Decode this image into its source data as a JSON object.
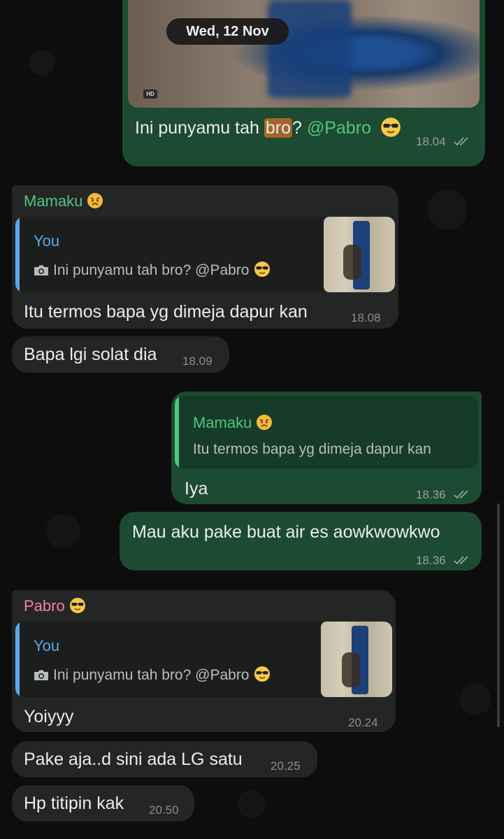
{
  "date_chip": "Wed, 12 Nov",
  "colors": {
    "outgoing_bubble": "#1d4a32",
    "incoming_bubble": "#242626",
    "mamaku_name": "#52c47f",
    "pabro_name": "#ff7dae",
    "you_name": "#5aa9e6"
  },
  "messages": {
    "m1": {
      "hd_badge": "HD",
      "text_before": "Ini punyamu tah ",
      "text_highlight": "bro",
      "text_after": "? ",
      "mention": "@Pabro",
      "time": "18.04"
    },
    "m2": {
      "sender": "Mamaku",
      "quote_name": "You",
      "quote_text": "Ini punyamu tah bro? @Pabro",
      "text": "Itu termos bapa yg dimeja dapur kan",
      "time": "18.08"
    },
    "m3": {
      "text": "Bapa lgi solat dia",
      "time": "18.09"
    },
    "m4": {
      "quote_name": "Mamaku",
      "quote_text": "Itu termos bapa yg dimeja dapur kan",
      "text": "Iya",
      "time": "18.36"
    },
    "m5": {
      "text": "Mau aku pake buat air es aowkwowkwo",
      "time": "18.36"
    },
    "m6": {
      "sender": "Pabro",
      "quote_name": "You",
      "quote_text": "Ini punyamu tah bro? @Pabro",
      "text": "Yoiyyy",
      "time": "20.24"
    },
    "m7": {
      "text": "Pake aja..d sini ada LG satu",
      "time": "20.25"
    },
    "m8": {
      "text": "Hp titipin kak",
      "time": "20.50"
    }
  }
}
